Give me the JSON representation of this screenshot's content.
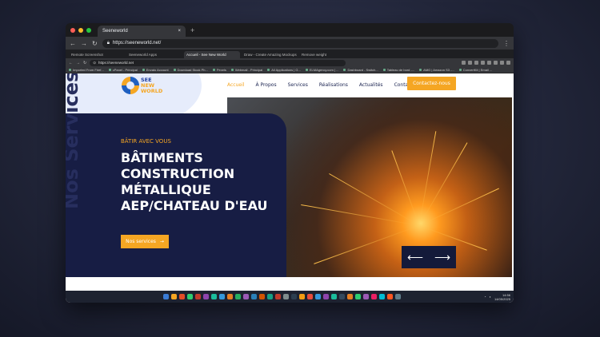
{
  "outer_browser": {
    "tab_title": "Seeneworld",
    "tab_close": "×",
    "new_tab": "+",
    "url": "https://seeneworld.net/",
    "back": "←",
    "forward": "→",
    "reload": "↻",
    "menu": "⋮"
  },
  "inner_browser": {
    "tabs": [
      {
        "label": "Remote Screenshot"
      },
      {
        "label": "Seeneworld Apps"
      },
      {
        "label": "Accueil - See New World"
      },
      {
        "label": "Draw - Create Amazing Mockups"
      },
      {
        "label": "Remove weight"
      }
    ],
    "url": "https://seeneworld.net",
    "bookmarks": [
      "Imported From Firef...",
      "cPanel - Principal",
      "Envato Account",
      "Download Stock Ph...",
      "Pexels",
      "Webmail - Principal",
      "All Applications | G...",
      "ELMAgency.com | ...",
      "Dashboard - Switch...",
      "Tableau de bord -...",
      "AMG | Amazon S3 -...",
      "ConvertKit | Email ..."
    ]
  },
  "site": {
    "logo": {
      "line1": "SEE",
      "line2": "NEW",
      "line3": "WORLD"
    },
    "nav": [
      "Accueil",
      "À Propos",
      "Services",
      "Réalisations",
      "Actualités",
      "Contact"
    ],
    "cta": "Contactez-nous",
    "hero": {
      "vertical_text": "Nos Services",
      "kicker": "BÂTIR AVEC VOUS",
      "title_lines": [
        "BÂTIMENTS",
        "CONSTRUCTION",
        "MÉTALLIQUE",
        "AEP/CHATEAU D'EAU"
      ],
      "button": "Nos services",
      "button_arrow": "→"
    },
    "slider": {
      "prev": "⟵",
      "next": "⟶"
    }
  },
  "taskbar": {
    "time": "14:56",
    "date": "14/05/2025",
    "icon_colors": [
      "#3a7bd5",
      "#f5a623",
      "#e34c26",
      "#2ecc71",
      "#c0392b",
      "#8e44ad",
      "#1abc9c",
      "#3498db",
      "#e67e22",
      "#27ae60",
      "#9b59b6",
      "#2980b9",
      "#d35400",
      "#16a085",
      "#c0392b",
      "#7f8c8d",
      "#2c3e50",
      "#f39c12",
      "#e74c3c",
      "#3498db",
      "#8e44ad",
      "#1abc9c",
      "#34495e",
      "#e67e22",
      "#2ecc71",
      "#9b59b6",
      "#e91e63",
      "#00bcd4",
      "#ff5722",
      "#607d8b"
    ]
  }
}
